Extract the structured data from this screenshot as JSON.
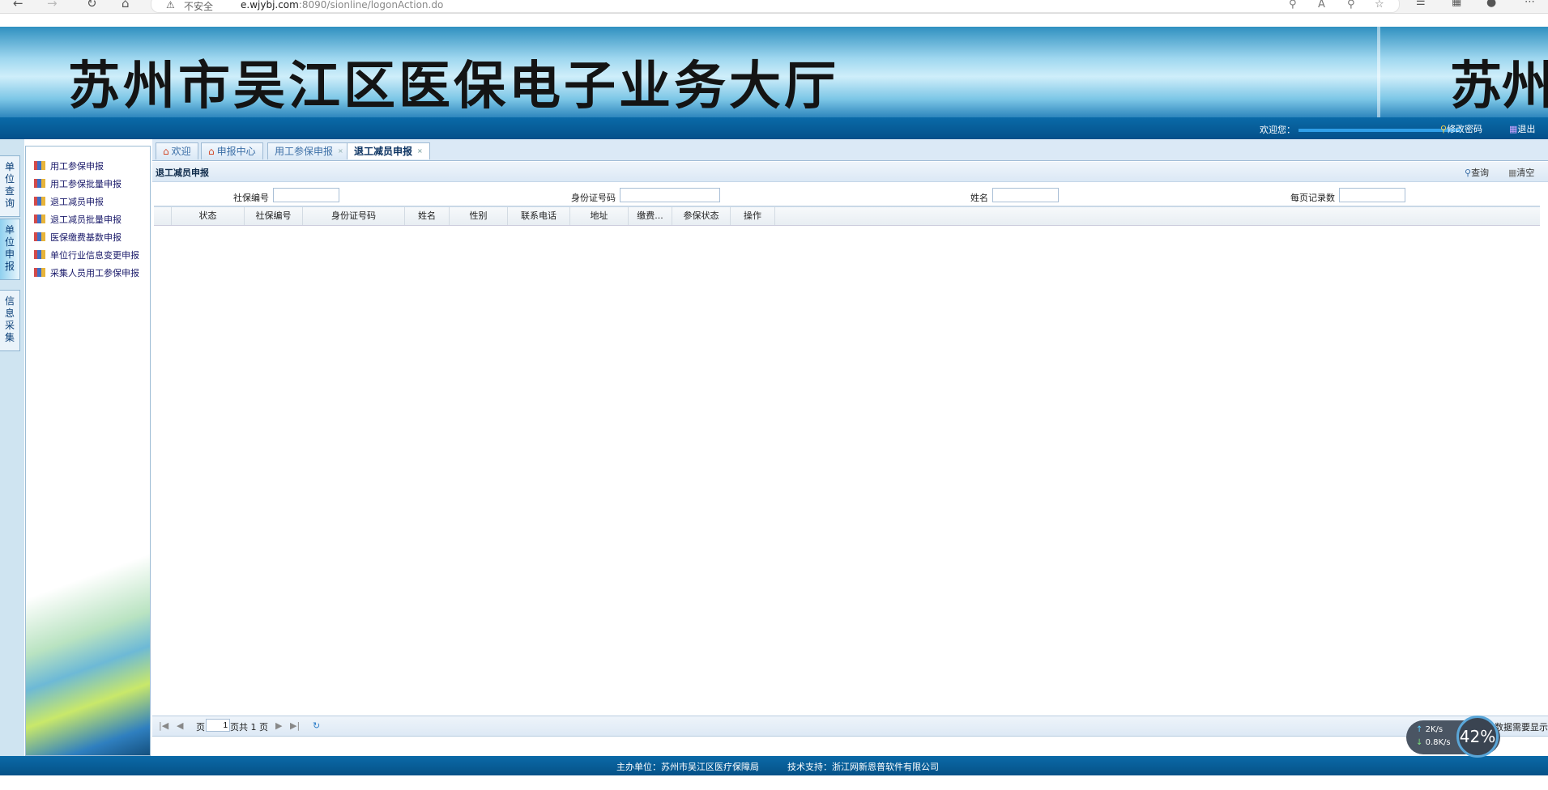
{
  "browser": {
    "not_secure": "不安全",
    "url_host": "e.wjybj.com",
    "url_rest": ":8090/sionline/logonAction.do"
  },
  "banner": {
    "title": "苏州市吴江区医保电子业务大厅",
    "title_right": "苏州"
  },
  "topbar": {
    "welcome": "欢迎您：",
    "change_password": "修改密码",
    "logout": "退出"
  },
  "leftnav": {
    "tabs": [
      {
        "label": "单位查询"
      },
      {
        "label": "单位申报"
      },
      {
        "label": "信息采集"
      }
    ],
    "items": [
      {
        "label": "用工参保申报"
      },
      {
        "label": "用工参保批量申报"
      },
      {
        "label": "退工减员申报"
      },
      {
        "label": "退工减员批量申报"
      },
      {
        "label": "医保缴费基数申报"
      },
      {
        "label": "单位行业信息变更申报"
      },
      {
        "label": "采集人员用工参保申报"
      }
    ]
  },
  "tabs": [
    {
      "label": "欢迎"
    },
    {
      "label": "申报中心"
    },
    {
      "label": "用工参保申报"
    },
    {
      "label": "退工减员申报"
    }
  ],
  "panel": {
    "title": "退工减员申报",
    "query": "查询",
    "clear": "清空"
  },
  "search": {
    "social_no_label": "社保编号",
    "id_no_label": "身份证号码",
    "name_label": "姓名",
    "page_size_label": "每页记录数",
    "social_no_value": "",
    "id_no_value": "",
    "name_value": "",
    "page_size_value": ""
  },
  "grid": {
    "columns": [
      "状态",
      "社保编号",
      "身份证号码",
      "姓名",
      "性别",
      "联系电话",
      "地址",
      "缴费...",
      "参保状态",
      "操作"
    ]
  },
  "pager": {
    "page_label": "页",
    "page_value": "1",
    "total": "页共 1 页",
    "right_text": "没有数据需要显示"
  },
  "footer": {
    "host": "主办单位：苏州市吴江区医疗保障局",
    "support": "技术支持：浙江网新恩普软件有限公司"
  },
  "netmonitor": {
    "up": "2K/s",
    "down": "0.8K/s",
    "percent": "42%"
  }
}
